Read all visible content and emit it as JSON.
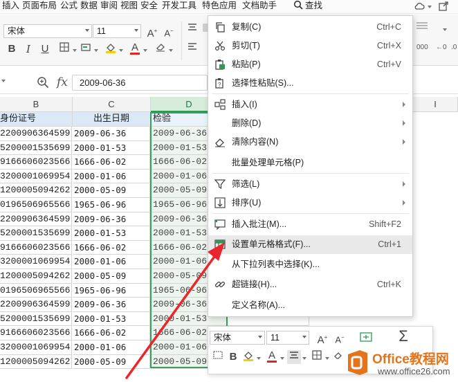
{
  "menubar": {
    "tabs": [
      "插入",
      "页面布局",
      "公式",
      "数据",
      "审阅",
      "视图",
      "安全",
      "开发工具",
      "特色应用",
      "文档助手"
    ],
    "search_label": "查找"
  },
  "ribbon": {
    "font_name": "宋体",
    "font_size": "11"
  },
  "formula_bar": {
    "fx_label": "fx",
    "value": "2009-06-36"
  },
  "sheet": {
    "col_headers": [
      "B",
      "C",
      "D",
      "I"
    ],
    "header_row": {
      "id": "身份证号",
      "birth": "出生日期",
      "check": "检验"
    },
    "rows": [
      [
        "2200906364599",
        "2009-06-36",
        "2009-06-36"
      ],
      [
        "5200001535699",
        "2000-01-53",
        "2000-01-53"
      ],
      [
        "9166606023566",
        "1666-06-02",
        "1666-06-02"
      ],
      [
        "3200001069954",
        "2000-01-06",
        "2000-01-06"
      ],
      [
        "1200005094262",
        "2000-05-09",
        "2000-05-09"
      ],
      [
        "0196506965566",
        "1965-06-96",
        "1965-06-96"
      ],
      [
        "2200906364599",
        "2009-06-36",
        "2009-06-36"
      ],
      [
        "5200001535699",
        "2000-01-53",
        "2000-01-53"
      ],
      [
        "9166606023566",
        "1666-06-02",
        "1666-06-02"
      ],
      [
        "3200001069954",
        "2000-01-06",
        "2000-01-06"
      ],
      [
        "1200005094262",
        "2000-05-09",
        "2000-05-09"
      ],
      [
        "0196506965566",
        "1965-06-96",
        "1965-06-96"
      ],
      [
        "2200906364599",
        "2009-06-36",
        "2009-06-36"
      ],
      [
        "5200001535699",
        "2000-01-53",
        "2000-01-53"
      ],
      [
        "9166606023566",
        "1666-06-02",
        "1666-06-02"
      ],
      [
        "3200001069954",
        "2000-01-06",
        "2000-01-06"
      ],
      [
        "1200005094262",
        "2000-05-09",
        "2000-05-09"
      ]
    ]
  },
  "context_menu": {
    "items": [
      {
        "label": "复制(C)",
        "shortcut": "Ctrl+C",
        "icon": "copy-icon"
      },
      {
        "label": "剪切(T)",
        "shortcut": "Ctrl+X",
        "icon": "scissors-icon"
      },
      {
        "label": "粘贴(P)",
        "shortcut": "Ctrl+V",
        "icon": "paste-icon"
      },
      {
        "label": "选择性粘贴(S)...",
        "shortcut": "",
        "icon": "paste-special-icon"
      },
      {
        "label": "插入(I)",
        "shortcut": "",
        "icon": "insert-cells-icon",
        "submenu": true
      },
      {
        "label": "删除(D)",
        "shortcut": "",
        "icon": "",
        "submenu": true
      },
      {
        "label": "清除内容(N)",
        "shortcut": "",
        "icon": "eraser-icon",
        "submenu": true
      },
      {
        "label": "批量处理单元格(P)",
        "shortcut": "",
        "icon": ""
      },
      {
        "label": "筛选(L)",
        "shortcut": "",
        "icon": "filter-icon",
        "submenu": true
      },
      {
        "label": "排序(U)",
        "shortcut": "",
        "icon": "sort-icon",
        "submenu": true
      },
      {
        "label": "插入批注(M)...",
        "shortcut": "Shift+F2",
        "icon": "comment-icon"
      },
      {
        "label": "设置单元格格式(F)...",
        "shortcut": "Ctrl+1",
        "icon": "format-cells-icon",
        "highlighted": true
      },
      {
        "label": "从下拉列表中选择(K)...",
        "shortcut": "",
        "icon": ""
      },
      {
        "label": "超链接(H)...",
        "shortcut": "Ctrl+K",
        "icon": "link-icon"
      },
      {
        "label": "定义名称(A)...",
        "shortcut": "",
        "icon": ""
      }
    ]
  },
  "mini_toolbar": {
    "font_name": "宋体",
    "font_size": "11"
  },
  "watermark": {
    "title": "Office教程网",
    "url": "www.office26.com"
  },
  "colors": {
    "selection_green": "#35a15a",
    "header_blue": "#dbe9f6",
    "arrow_red": "#e8262c",
    "watermark_orange": "#e4741b"
  }
}
